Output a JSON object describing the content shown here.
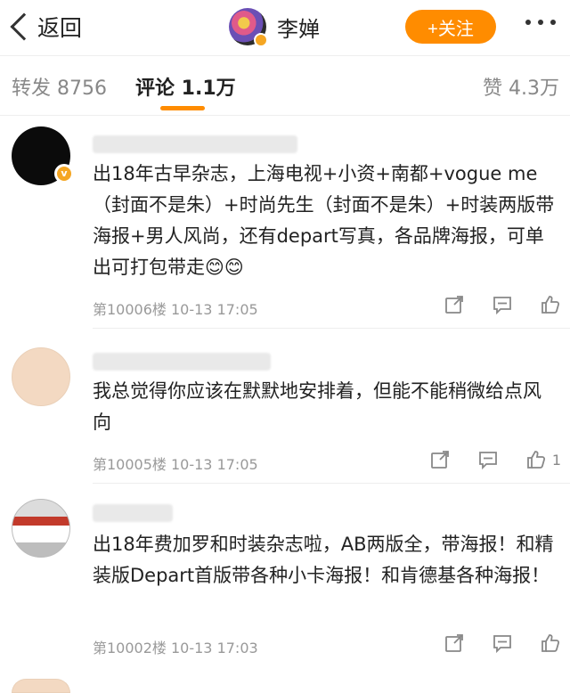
{
  "header": {
    "back_label": "返回",
    "user_name": "李婵",
    "follow_label": "+关注"
  },
  "tabs": {
    "repost": "转发 8756",
    "comment": "评论 1.1万",
    "like": "赞 4.3万"
  },
  "comments": [
    {
      "text": "出18年古早杂志，上海电视+小资+南都+vogue me（封面不是朱）+时尚先生（封面不是朱）+时装两版带海报+男人风尚，还有depart写真，各品牌海报，可单出可打包带走😊😊",
      "meta": "第10006楼 10-13 17:05",
      "likes": ""
    },
    {
      "text": "我总觉得你应该在默默地安排着，但能不能稍微给点风向",
      "meta": "第10005楼 10-13 17:05",
      "likes": "1"
    },
    {
      "text": "出18年费加罗和时装杂志啦，AB两版全，带海报！和精装版Depart首版带各种小卡海报！和肯德基各种海报！",
      "meta": "第10002楼 10-13 17:03",
      "likes": ""
    }
  ],
  "colors": {
    "accent": "#ff8c00"
  }
}
